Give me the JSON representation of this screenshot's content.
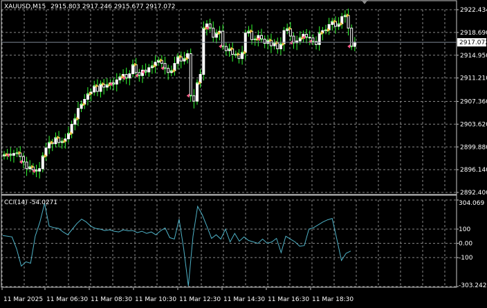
{
  "header": {
    "symbol": "XAUUSD,M15",
    "ohlc": "2915.803 2917.246 2915.677 2917.072"
  },
  "colors": {
    "background": "#000000",
    "grid": "#8a8a8a",
    "frame": "#c8c8c8",
    "candle_up": "#ffffff",
    "wick": "#33ff33",
    "bid_line": "#7f8a96",
    "cci_line": "#4fb3c8",
    "arrow_buy": "#f0c040",
    "arrow_sell": "#ff5a8a",
    "marker": "#66ff66"
  },
  "icons": {
    "shift_marker": "triangle-down-icon"
  },
  "chart_data": [
    {
      "type": "candlestick",
      "panel": "price",
      "ylim": [
        2892.4,
        2922.434
      ],
      "y_ticks": [
        "2922.434",
        "2918.690",
        "2914.950",
        "2911.210",
        "2907.360",
        "2903.620",
        "2899.880",
        "2896.140",
        "2892.400"
      ],
      "current_price_label": "2917.072",
      "current_price": 2917.072,
      "x_ticks": [
        "11 Mar 2025",
        "11 Mar 06:30",
        "11 Mar 08:30",
        "11 Mar 10:30",
        "11 Mar 12:30",
        "11 Mar 14:30",
        "11 Mar 16:30",
        "11 Mar 18:30"
      ],
      "close": [
        2898.6,
        2898.7,
        2898.5,
        2898.8,
        2898.9,
        2898.3,
        2897.4,
        2896.3,
        2896.6,
        2896.1,
        2895.9,
        2896.3,
        2898.4,
        2899.7,
        2900.6,
        2900.4,
        2901.4,
        2900.6,
        2900.8,
        2901.2,
        2902.1,
        2903.6,
        2904.5,
        2906.2,
        2906.9,
        2907.7,
        2908.6,
        2908.9,
        2909.9,
        2909.0,
        2910.2,
        2909.7,
        2910.1,
        2910.4,
        2910.2,
        2910.9,
        2911.4,
        2911.8,
        2911.2,
        2911.9,
        2913.4,
        2912.1,
        2911.6,
        2912.5,
        2912.2,
        2912.9,
        2913.2,
        2913.8,
        2914.1,
        2913.6,
        2912.8,
        2912.1,
        2912.4,
        2913.6,
        2914.7,
        2914.0,
        2914.4,
        2915.2,
        2908.3,
        2907.4,
        2910.4,
        2911.8,
        2919.4,
        2920.1,
        2919.4,
        2917.9,
        2918.6,
        2918.9,
        2916.4,
        2915.7,
        2916.0,
        2915.1,
        2915.1,
        2914.4,
        2915.4,
        2918.6,
        2918.9,
        2917.5,
        2917.6,
        2918.2,
        2917.6,
        2916.9,
        2917.4,
        2916.5,
        2917.0,
        2916.0,
        2916.8,
        2919.0,
        2919.3,
        2918.1,
        2917.0,
        2917.3,
        2917.8,
        2918.4,
        2917.9,
        2917.8,
        2917.2,
        2916.7,
        2918.6,
        2919.0,
        2919.1,
        2920.0,
        2920.5,
        2919.7,
        2920.1,
        2921.3,
        2921.5,
        2919.4,
        2916.4,
        2917.1
      ]
    },
    {
      "type": "line",
      "panel": "indicator",
      "title": "CCI(14) -54.0271",
      "ylim": [
        -303.242,
        304.069
      ],
      "y_ticks": [
        304.069,
        100,
        0.0,
        -100,
        -303.242
      ],
      "y_tick_labels": [
        "304.069",
        "100",
        "0.00",
        "-100",
        "-303.242"
      ],
      "series": [
        {
          "name": "CCI(14)",
          "values": [
            55,
            50,
            45,
            -40,
            -160,
            -130,
            -140,
            50,
            150,
            280,
            120,
            110,
            105,
            80,
            60,
            100,
            140,
            170,
            150,
            120,
            105,
            100,
            90,
            95,
            85,
            80,
            95,
            88,
            90,
            75,
            85,
            70,
            80,
            60,
            88,
            108,
            40,
            30,
            170,
            -40,
            -300,
            50,
            260,
            200,
            120,
            35,
            60,
            30,
            100,
            10,
            70,
            15,
            45,
            20,
            10,
            0,
            30,
            0,
            10,
            35,
            -65,
            50,
            30,
            10,
            -20,
            -15,
            100,
            110,
            130,
            150,
            165,
            175,
            30,
            -120,
            -70,
            -54
          ]
        }
      ]
    }
  ]
}
